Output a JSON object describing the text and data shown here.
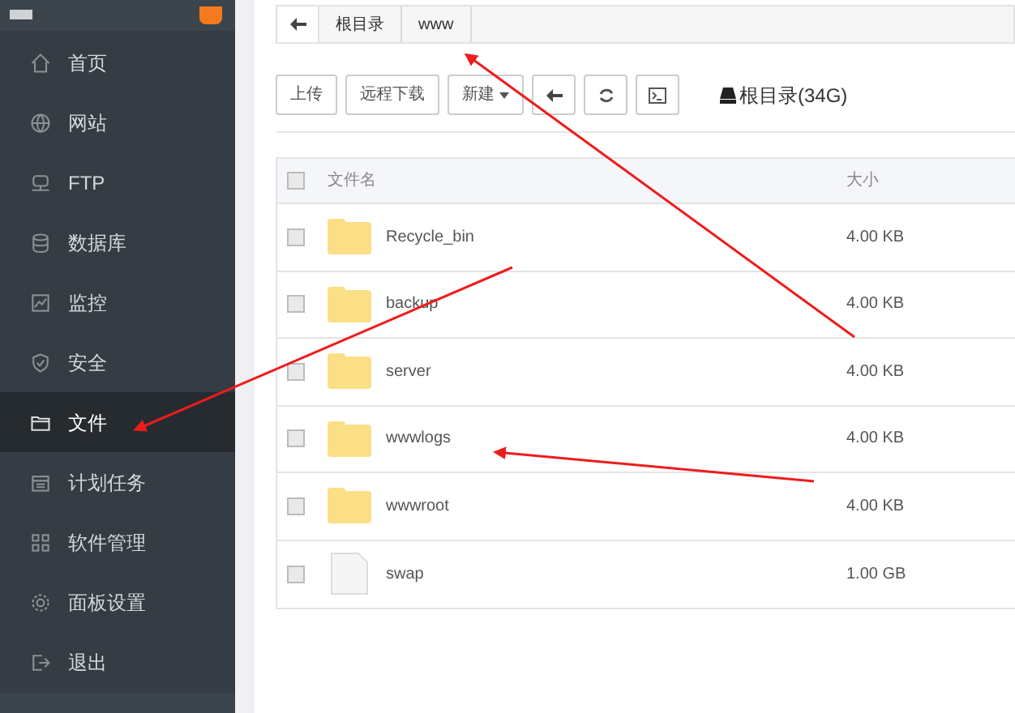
{
  "sidebar": {
    "items": [
      {
        "label": "首页",
        "selected": false
      },
      {
        "label": "网站",
        "selected": false
      },
      {
        "label": "FTP",
        "selected": false
      },
      {
        "label": "数据库",
        "selected": false
      },
      {
        "label": "监控",
        "selected": false
      },
      {
        "label": "安全",
        "selected": false
      },
      {
        "label": "文件",
        "selected": true
      },
      {
        "label": "计划任务",
        "selected": false
      },
      {
        "label": "软件管理",
        "selected": false
      },
      {
        "label": "面板设置",
        "selected": false
      },
      {
        "label": "退出",
        "selected": false
      }
    ]
  },
  "breadcrumb": [
    "根目录",
    "www"
  ],
  "toolbar": {
    "buttons": [
      {
        "kind": "text",
        "label": "上传"
      },
      {
        "kind": "text",
        "label": "远程下载"
      },
      {
        "kind": "dropdown",
        "label": "新建"
      },
      {
        "kind": "back"
      },
      {
        "kind": "refresh"
      },
      {
        "kind": "terminal"
      }
    ],
    "disk": "根目录(34G)"
  },
  "table": {
    "select_all_checked": false,
    "columns": [
      "文件名",
      "大小"
    ],
    "rows": [
      {
        "kind": "folder",
        "name": "Recycle_bin",
        "size": "4.00 KB",
        "checked": false
      },
      {
        "kind": "folder",
        "name": "backup",
        "size": "4.00 KB",
        "checked": false
      },
      {
        "kind": "folder",
        "name": "server",
        "size": "4.00 KB",
        "checked": false
      },
      {
        "kind": "folder",
        "name": "wwwlogs",
        "size": "4.00 KB",
        "checked": false
      },
      {
        "kind": "folder",
        "name": "wwwroot",
        "size": "4.00 KB",
        "checked": false
      },
      {
        "kind": "file",
        "name": "swap",
        "size": "1.00 GB",
        "checked": false
      }
    ]
  }
}
